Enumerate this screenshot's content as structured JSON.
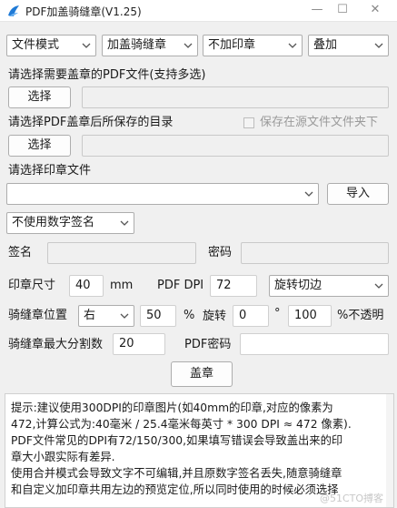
{
  "window": {
    "title": "PDF加盖骑缝章(V1.25)",
    "minimize": "—",
    "maximize": "☐",
    "close": "✕"
  },
  "top_row": {
    "file_mode": "文件模式",
    "stamp_type": "加盖骑缝章",
    "print_option": "不加印章",
    "overlay": "叠加"
  },
  "pdf_select": {
    "label": "请选择需要盖章的PDF文件(支持多选)",
    "button": "选择",
    "path_value": ""
  },
  "output_dir": {
    "label": "请选择PDF盖章后所保存的目录",
    "checkbox_label": "保存在源文件文件夹下",
    "checkbox_checked": false,
    "button": "选择",
    "path_value": ""
  },
  "stamp_file": {
    "label": "请选择印章文件",
    "value": "",
    "import_button": "导入"
  },
  "signature": {
    "mode": "不使用数字签名",
    "name_label": "签名",
    "name_value": "",
    "password_label": "密码",
    "password_value": ""
  },
  "stamp_size": {
    "label": "印章尺寸",
    "value": "40",
    "unit": "mm",
    "dpi_label": "PDF DPI",
    "dpi_value": "72",
    "rotate_mode": "旋转切边"
  },
  "seam_position": {
    "label": "骑缝章位置",
    "side": "右",
    "percent_value": "50",
    "percent_sign": "%",
    "rotate_label": "旋转",
    "rotate_value": "0",
    "degree_sign": "°",
    "opacity_value": "100",
    "opacity_label": "%不透明"
  },
  "seam_split": {
    "label": "骑缝章最大分割数",
    "value": "20",
    "pdf_password_label": "PDF密码",
    "pdf_password_value": ""
  },
  "stamp_button": "盖章",
  "info_text": {
    "line1": "提示:建议使用300DPI的印章图片(如40mm的印章,对应的像素为",
    "line2": "472,计算公式为:40毫米 / 25.4毫米每英寸 * 300 DPI ≈ 472 像素).",
    "line3": "PDF文件常见的DPI有72/150/300,如果填写错误会导致盖出来的印",
    "line4": "章大小跟实际有差异.",
    "line5": "使用合并模式会导致文字不可编辑,并且原数字签名丢失,随意骑缝章",
    "line6": "和自定义加印章共用左边的预览定位,所以同时使用的时候必须选择"
  },
  "watermark": "@51CTO搏客",
  "colors": {
    "window_bg": "#f0f0f0",
    "border": "#adadad",
    "icon_blue": "#1f7ad6"
  },
  "icons": [
    "app-icon",
    "chevron-down-icon",
    "minimize-icon",
    "maximize-icon",
    "close-icon"
  ]
}
